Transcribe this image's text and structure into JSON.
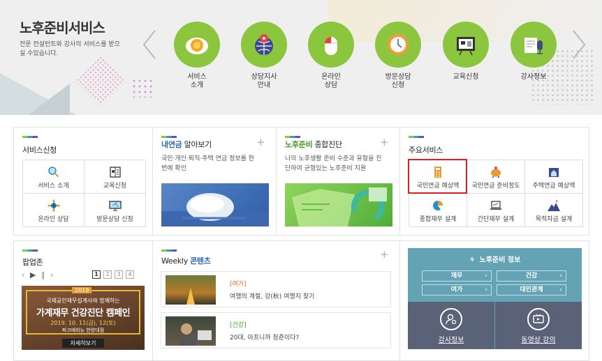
{
  "hero": {
    "title": "노후준비서비스",
    "desc": "전문 컨설턴트와 강사의 서비스를 받으실 수있습니다.",
    "services": [
      {
        "label": "서비스\n소개",
        "icon": "coffee-cup-icon"
      },
      {
        "label": "상담지사\n안내",
        "icon": "globe-pin-icon"
      },
      {
        "label": "온라인\n상담",
        "icon": "mouse-icon"
      },
      {
        "label": "방문상담\n신청",
        "icon": "clock-icon"
      },
      {
        "label": "교육신청",
        "icon": "board-icon"
      },
      {
        "label": "강사정보",
        "icon": "microphone-icon"
      }
    ]
  },
  "service_apply": {
    "title": "서비스신청",
    "items": [
      {
        "label": "서비스 소개",
        "icon": "magnifier-icon"
      },
      {
        "label": "교육신청",
        "icon": "book-icon"
      },
      {
        "label": "온라인 상담",
        "icon": "network-icon"
      },
      {
        "label": "방문상담 신청",
        "icon": "monitor-icon"
      }
    ]
  },
  "my_pension": {
    "title_bold": "내연금",
    "title_rest": " 알아보기",
    "desc": "국민·개인·퇴직·주택 연금 정보를 한 번에 확인"
  },
  "diagnosis": {
    "title_bold": "노후준비",
    "title_rest": " 종합진단",
    "desc": "나의 노후생활 준비 수준과 유형을 진단하여 균형있는 노후준비 지원"
  },
  "main_services": {
    "title": "주요서비스",
    "items": [
      {
        "label": "국민연금 예상액",
        "icon": "calculator-icon"
      },
      {
        "label": "국민연금 준비정도",
        "icon": "piggy-bank-icon"
      },
      {
        "label": "주택연금 예상액",
        "icon": "house-book-icon"
      },
      {
        "label": "종합재무 설계",
        "icon": "pie-chart-icon"
      },
      {
        "label": "간단재무 설계",
        "icon": "laptop-icon"
      },
      {
        "label": "목적자금 설계",
        "icon": "mountain-flag-icon"
      }
    ]
  },
  "popup": {
    "title": "팝업존",
    "pages": [
      "1",
      "2",
      "3",
      "4"
    ],
    "banner": {
      "year": "2019",
      "line1": "국제공인재무설계사와 함께하는",
      "line2": "가계재무 건강진단 캠페인",
      "date": "2019. 10. 11(금), 12(토)",
      "place": "파크에비뉴 한양대점",
      "btn": "자세히보기"
    }
  },
  "weekly": {
    "title": "Weekly",
    "title_bold": "콘텐츠",
    "items": [
      {
        "cat": "[여가]",
        "title": "여행의 계절, 강(秋) 여행지 찾기"
      },
      {
        "cat": "[건강]",
        "title": "20대, 아프니까 청춘이다?"
      }
    ]
  },
  "info": {
    "title": "노후준비 정보",
    "buttons": [
      "재무",
      "건강",
      "여가",
      "대인관계"
    ],
    "bottom": [
      "강사정보",
      "동영상 강의"
    ]
  }
}
